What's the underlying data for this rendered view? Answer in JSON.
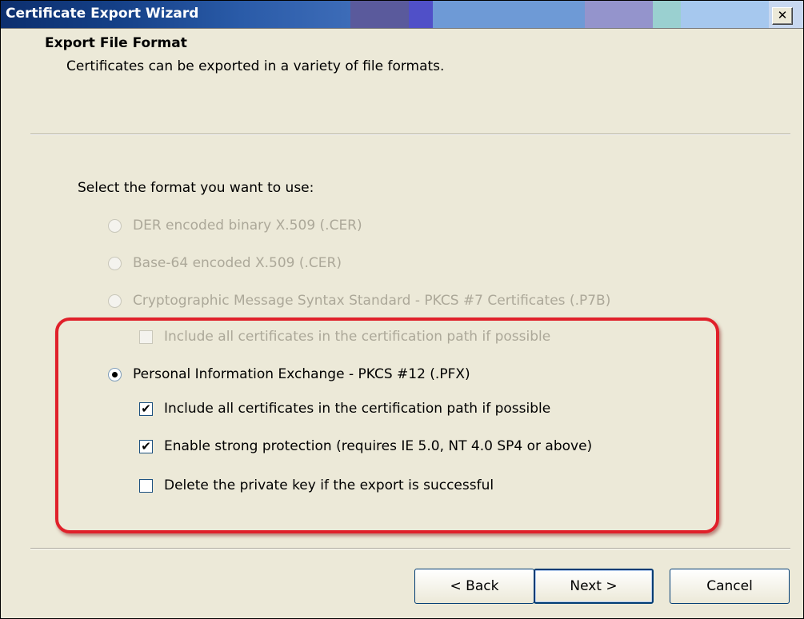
{
  "window": {
    "title": "Certificate Export Wizard",
    "close_glyph": "✕"
  },
  "header": {
    "title": "Export File Format",
    "subtitle": "Certificates can be exported in a variety of file formats."
  },
  "prompt": "Select the format you want to use:",
  "options": {
    "der": {
      "label": "DER encoded binary X.509 (.CER)",
      "selected": false,
      "enabled": false
    },
    "base64": {
      "label": "Base-64 encoded X.509 (.CER)",
      "selected": false,
      "enabled": false
    },
    "pkcs7": {
      "label": "Cryptographic Message Syntax Standard - PKCS #7 Certificates (.P7B)",
      "selected": false,
      "enabled": false
    },
    "pkcs7_include": {
      "label": "Include all certificates in the certification path if possible",
      "checked": false,
      "enabled": false
    },
    "pfx": {
      "label": "Personal Information Exchange - PKCS #12 (.PFX)",
      "selected": true,
      "enabled": true
    },
    "pfx_include": {
      "label": "Include all certificates in the certification path if possible",
      "checked": true,
      "enabled": true
    },
    "pfx_strong": {
      "label": "Enable strong protection (requires IE 5.0, NT 4.0 SP4 or above)",
      "checked": true,
      "enabled": true
    },
    "pfx_delete": {
      "label": "Delete the private key if the export is successful",
      "checked": false,
      "enabled": true
    }
  },
  "buttons": {
    "back": "< Back",
    "next": "Next >",
    "cancel": "Cancel"
  },
  "colors": {
    "highlight": "#e0202a",
    "window_bg": "#ece9d8",
    "disabled_text": "#aca899"
  }
}
